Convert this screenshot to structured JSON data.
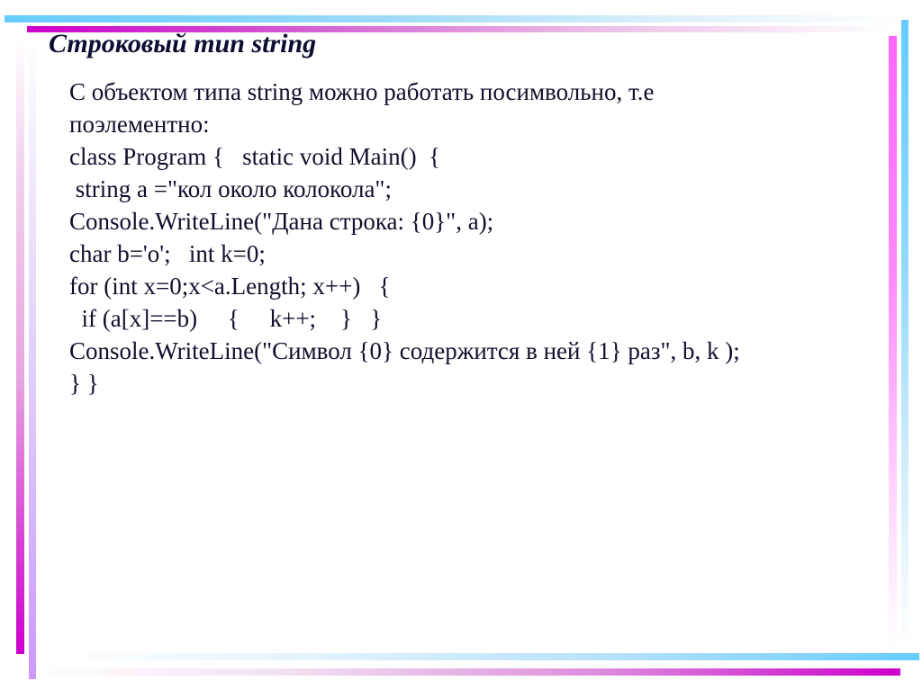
{
  "slide": {
    "title": "Строковый тип string",
    "lines": [
      "С объектом типа string можно работать посимвольно, т.е",
      "поэлементно:",
      "class Program {   static void Main()  {",
      " string a =\"кол около колокола\";",
      "Console.WriteLine(\"Дана строка: {0}\", a);",
      "char b='o';   int k=0;",
      "for (int x=0;x<a.Length; x++)   {",
      "  if (a[x]==b)     {     k++;    }   }",
      "Console.WriteLine(\"Символ {0} содержится в ней {1} раз\", b, k );",
      "} }"
    ]
  },
  "theme": {
    "accent_magenta": "#cc00cc",
    "accent_pink": "#ff66ff",
    "accent_blue": "#66ccff",
    "accent_lavender": "#cc99ff",
    "text_color": "#10102e"
  }
}
